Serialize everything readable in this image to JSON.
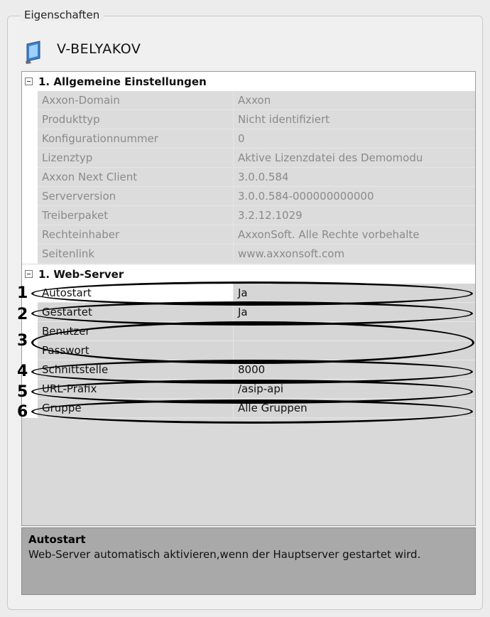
{
  "panel": {
    "group_label": "Eigenschaften"
  },
  "header": {
    "device_name": "V-BELYAKOV",
    "icon": "monitor-icon"
  },
  "categories": [
    {
      "label": "1. Allgemeine Einstellungen",
      "rows": [
        {
          "name": "Axxon-Domain",
          "value": "Axxon"
        },
        {
          "name": "Produkttyp",
          "value": "Nicht identifiziert"
        },
        {
          "name": "Konfigurationnummer",
          "value": "0"
        },
        {
          "name": "Lizenztyp",
          "value": "Aktive Lizenzdatei des Demomodu"
        },
        {
          "name": "Axxon Next Client",
          "value": "3.0.0.584"
        },
        {
          "name": "Serverversion",
          "value": "3.0.0.584-000000000000"
        },
        {
          "name": "Treiberpaket",
          "value": "3.2.12.1029"
        },
        {
          "name": "Rechteinhaber",
          "value": "AxxonSoft. Alle Rechte vorbehalte"
        },
        {
          "name": "Seitenlink",
          "value": "www.axxonsoft.com"
        }
      ]
    },
    {
      "label": "1. Web-Server",
      "rows": [
        {
          "name": "Autostart",
          "value": "Ja"
        },
        {
          "name": "Gestartet",
          "value": "Ja"
        },
        {
          "name": "Benutzer",
          "value": ""
        },
        {
          "name": "Passwort",
          "value": ""
        },
        {
          "name": "Schnittstelle",
          "value": "8000"
        },
        {
          "name": "URL-Präfix",
          "value": "/asip-api"
        },
        {
          "name": "Gruppe",
          "value": "Alle Gruppen"
        }
      ]
    }
  ],
  "annotations": [
    "1",
    "2",
    "3",
    "4",
    "5",
    "6"
  ],
  "description": {
    "title": "Autostart",
    "text": "Web-Server automatisch aktivieren,wenn der Hauptserver gestartet wird."
  }
}
